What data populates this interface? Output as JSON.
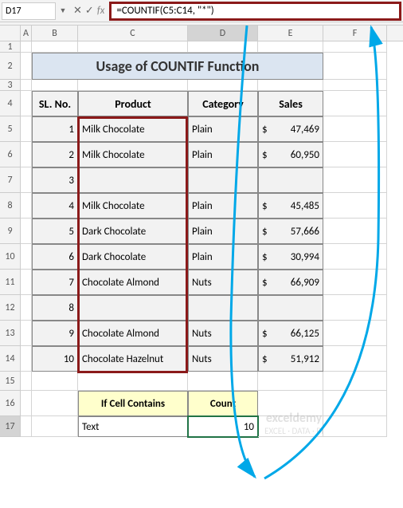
{
  "cellRef": "D17",
  "formula": "=COUNTIF(C5:C14, \"*\")",
  "title": "Usage of COUNTIF Function",
  "columns": [
    "A",
    "B",
    "C",
    "D",
    "E",
    "F"
  ],
  "activeCol": "D",
  "activeRow": "17",
  "headers": {
    "sl": "SL. No.",
    "product": "Product",
    "category": "Category",
    "sales": "Sales"
  },
  "rows": [
    {
      "n": "1",
      "sl": "1",
      "prod": "Milk Chocolate",
      "cat": "Plain",
      "sale": "47,469"
    },
    {
      "n": "2",
      "sl": "2",
      "prod": "Milk Chocolate",
      "cat": "Plain",
      "sale": "60,950"
    },
    {
      "n": "3",
      "sl": "3",
      "prod": "",
      "cat": "",
      "sale": ""
    },
    {
      "n": "4",
      "sl": "4",
      "prod": "Milk Chocolate",
      "cat": "Plain",
      "sale": "45,485"
    },
    {
      "n": "5",
      "sl": "5",
      "prod": "Dark Chocolate",
      "cat": "Plain",
      "sale": "57,666"
    },
    {
      "n": "6",
      "sl": "6",
      "prod": "Dark Chocolate",
      "cat": "Plain",
      "sale": "30,994"
    },
    {
      "n": "7",
      "sl": "7",
      "prod": "Chocolate Almond",
      "cat": "Nuts",
      "sale": "66,909"
    },
    {
      "n": "8",
      "sl": "8",
      "prod": "",
      "cat": "",
      "sale": ""
    },
    {
      "n": "9",
      "sl": "9",
      "prod": "Chocolate Almond",
      "cat": "Nuts",
      "sale": "66,125"
    },
    {
      "n": "10",
      "sl": "10",
      "prod": "Chocolate Hazelnut",
      "cat": "Nuts",
      "sale": "51,912"
    }
  ],
  "ifcell": {
    "h1": "If Cell Contains",
    "h2": "Count",
    "val1": "Text",
    "val2": "10"
  },
  "currency": "$",
  "watermark": {
    "brand": "exceldemy",
    "tag": "EXCEL · DATA · BI"
  }
}
